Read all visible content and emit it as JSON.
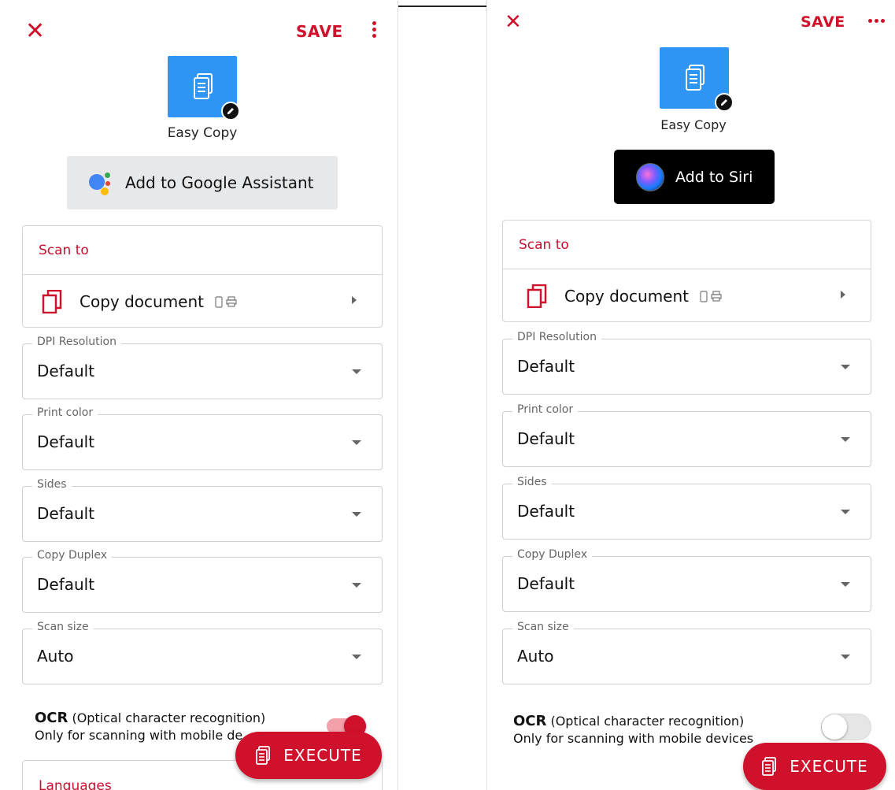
{
  "colors": {
    "accent": "#d0112b",
    "app_icon_bg": "#2f95f4"
  },
  "left": {
    "header": {
      "save_label": "SAVE"
    },
    "app": {
      "title": "Easy Copy"
    },
    "assistant_button": {
      "label": "Add to Google Assistant",
      "icon": "google-assistant-icon"
    },
    "scan_to": {
      "header": "Scan to",
      "item_label": "Copy document"
    },
    "fields": [
      {
        "label": "DPI Resolution",
        "value": "Default"
      },
      {
        "label": "Print color",
        "value": "Default"
      },
      {
        "label": "Sides",
        "value": "Default"
      },
      {
        "label": "Copy Duplex",
        "value": "Default"
      },
      {
        "label": "Scan size",
        "value": "Auto"
      }
    ],
    "ocr": {
      "title": "OCR",
      "title_rest": " (Optical character recognition)",
      "subtitle": "Only for scanning with mobile de",
      "enabled": true
    },
    "languages_header": "Languages",
    "execute_label": "EXECUTE"
  },
  "right": {
    "header": {
      "save_label": "SAVE"
    },
    "app": {
      "title": "Easy Copy"
    },
    "siri_button": {
      "label": "Add to Siri",
      "icon": "siri-icon"
    },
    "scan_to": {
      "header": "Scan to",
      "item_label": "Copy document"
    },
    "fields": [
      {
        "label": "DPI Resolution",
        "value": "Default"
      },
      {
        "label": "Print color",
        "value": "Default"
      },
      {
        "label": "Sides",
        "value": "Default"
      },
      {
        "label": "Copy Duplex",
        "value": "Default"
      },
      {
        "label": "Scan size",
        "value": "Auto"
      }
    ],
    "ocr": {
      "title": "OCR",
      "title_rest": " (Optical character recognition)",
      "subtitle": "Only for scanning with mobile devices",
      "enabled": false
    },
    "execute_label": "EXECUTE"
  }
}
